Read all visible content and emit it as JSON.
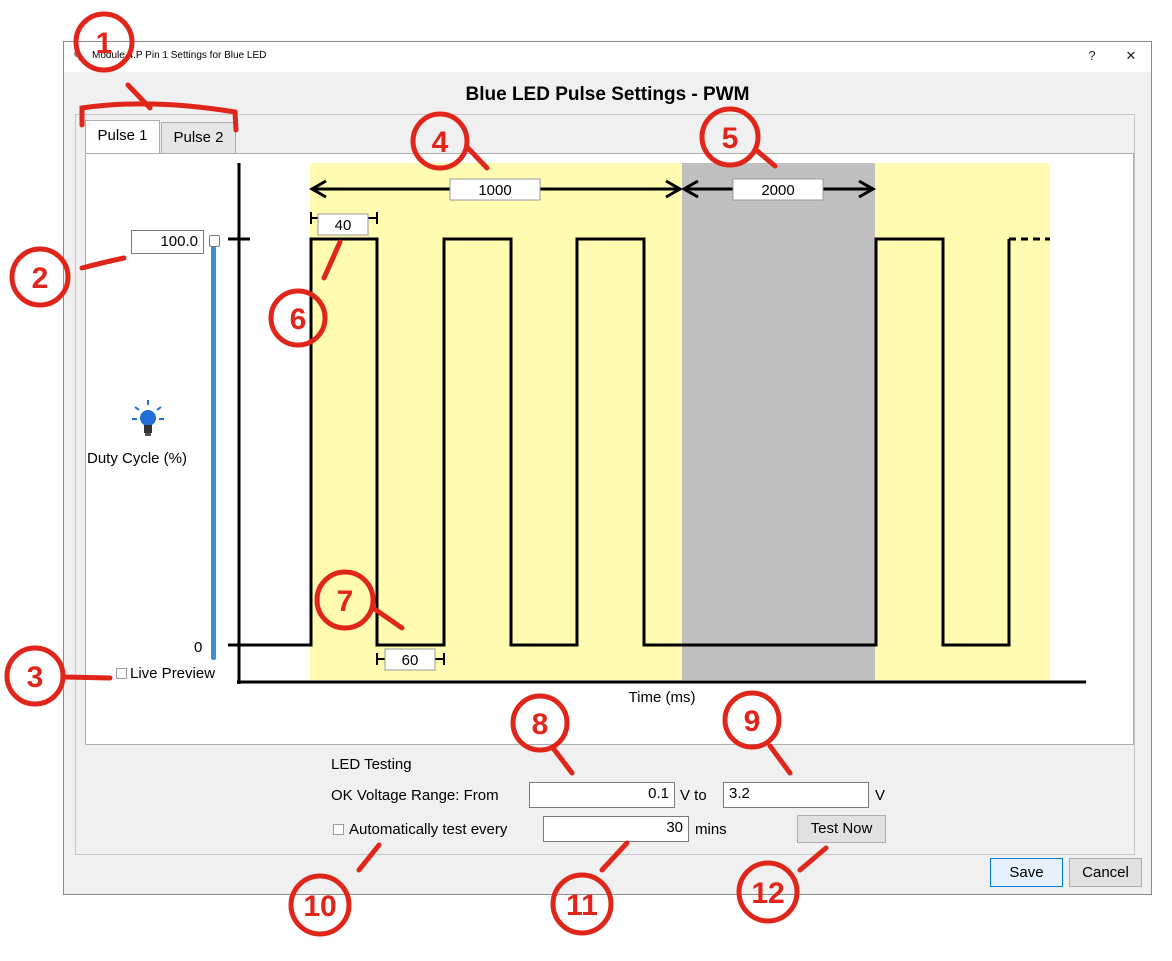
{
  "window": {
    "title": "Module 4.P Pin 1 Settings for Blue LED",
    "help_glyph": "?",
    "close_glyph": "✕"
  },
  "heading": "Blue LED Pulse Settings - PWM",
  "tabs": [
    {
      "label": "Pulse 1",
      "active": true
    },
    {
      "label": "Pulse 2",
      "active": false
    }
  ],
  "duty": {
    "max_value": "100.0",
    "min_label": "0",
    "label": "Duty Cycle (%)",
    "icon": "lightbulb-icon",
    "icon_color": "#1f6fd6"
  },
  "live_preview": {
    "label": "Live Preview",
    "checked": false
  },
  "chart_data": {
    "type": "line",
    "xlabel": "Time (ms)",
    "ylabel": "",
    "description_values": {
      "on_time_ms": "40",
      "off_time_ms": "60",
      "burst_duration_ms": "1000",
      "pause_duration_ms": "2000"
    },
    "cycle_pattern": [
      "on",
      "off",
      "on",
      "off",
      "on",
      "off",
      "pause",
      "on",
      "off",
      "on"
    ],
    "colors": {
      "active_band": "#fffbb0",
      "pause_band": "#c0c0c0",
      "signal": "#000000"
    }
  },
  "led_testing": {
    "title": "LED Testing",
    "range_label": "OK Voltage Range: From",
    "from_value": "0.1",
    "to_label": "V to",
    "to_value": "3.2",
    "unit": "V",
    "auto_label": "Automatically test every",
    "auto_checked": false,
    "interval_value": "30",
    "interval_unit": "mins",
    "test_button": "Test Now"
  },
  "buttons": {
    "save": "Save",
    "cancel": "Cancel"
  },
  "annotations": {
    "color": "#e0251b",
    "numbers": [
      "1",
      "2",
      "3",
      "4",
      "5",
      "6",
      "7",
      "8",
      "9",
      "10",
      "11",
      "12"
    ]
  }
}
